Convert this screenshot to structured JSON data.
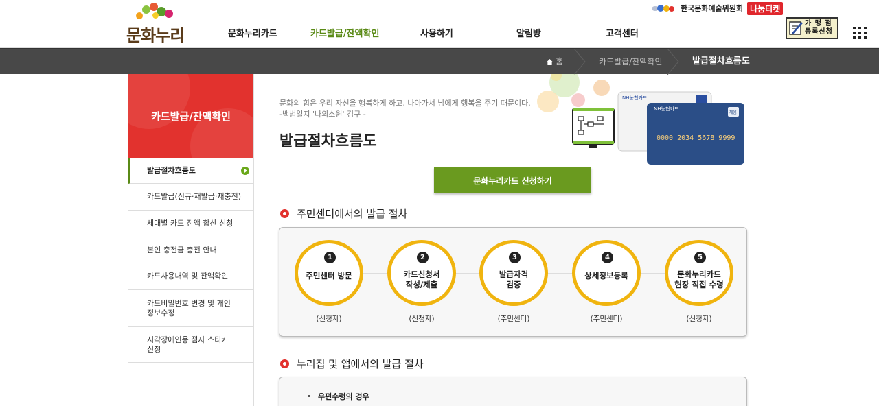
{
  "header": {
    "logo_text": "문화누리",
    "nav": [
      "문화누리카드",
      "카드발급/잔액확인",
      "사용하기",
      "알림방",
      "고객센터"
    ],
    "arko_label": "한국문화예술위원회",
    "nanum_label": "나눔티켓",
    "merchant_label_1": "가 맹 점",
    "merchant_label_2": "등록신청",
    "icons": {
      "grid": "grid-menu-icon",
      "home": "home-icon"
    }
  },
  "breadcrumb": {
    "home": "홈",
    "level1": "카드발급/잔액확인",
    "current": "발급절차흐름도"
  },
  "sidebar": {
    "title": "카드발급/잔액확인",
    "items": [
      {
        "label": "발급절차흐름도"
      },
      {
        "label": "카드발급(신규·재발급·재충전)"
      },
      {
        "label": "세대별 카드 잔액 합산 신청"
      },
      {
        "label": "본인 충전금 충전 안내"
      },
      {
        "label": "카드사용내역 및 잔액확인"
      },
      {
        "label": "카드비밀번호 변경 및 개인정보수정"
      },
      {
        "label": "시각장애인용 점자 스티커 신청"
      }
    ]
  },
  "main": {
    "quote_line1": "문화의 힘은 우리 자신을 행복하게 하고, 나아가서 남에게 행복을 주기 때문이다.",
    "quote_line2": "-백범일지 '나의소원' 김구 -",
    "title": "발급절차흐름도",
    "apply_button": "문화누리카드 신청하기",
    "card_art": {
      "brand": "NH농협카드",
      "number": "0000 2034 5678 9999",
      "badge": "체음"
    },
    "section1": {
      "title": "주민센터에서의 발급 절차",
      "steps": [
        {
          "num": "1",
          "line1": "주민센터 방문",
          "line2": "",
          "who": "(신청자)"
        },
        {
          "num": "2",
          "line1": "카드신청서",
          "line2": "작성/제출",
          "who": "(신청자)"
        },
        {
          "num": "3",
          "line1": "발급자격",
          "line2": "검증",
          "who": "(주민센터)"
        },
        {
          "num": "4",
          "line1": "상세정보등록",
          "line2": "",
          "who": "(주민센터)"
        },
        {
          "num": "5",
          "line1": "문화누리카드",
          "line2": "현장 직접 수령",
          "who": "(신청자)"
        }
      ]
    },
    "section2": {
      "title": "누리집 및 앱에서의 발급 절차",
      "sub_item": "우편수령의 경우"
    }
  },
  "colors": {
    "accent_green": "#6a9a1f",
    "sidebar_red": "#e2322e",
    "step_ring": "#f0b40f",
    "crumb_bar": "#484848"
  }
}
